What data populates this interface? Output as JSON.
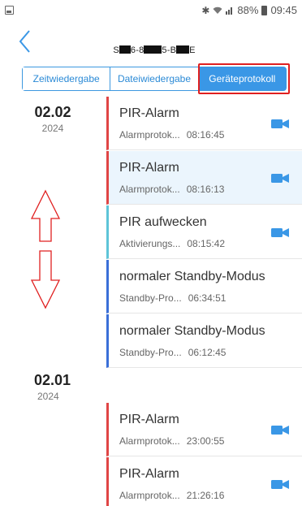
{
  "statusbar": {
    "bluetooth": "✱",
    "battery_percent": "88%",
    "time": "09:45"
  },
  "header": {
    "title_parts": [
      "S",
      "6-8",
      "5-B",
      "E"
    ]
  },
  "tabs": [
    {
      "label": "Zeitwiedergabe",
      "active": false
    },
    {
      "label": "Dateiwiedergabe",
      "active": false
    },
    {
      "label": "Geräteprotokoll",
      "active": true
    }
  ],
  "groups": [
    {
      "day": "02.02",
      "year": "2024",
      "entries": [
        {
          "title": "PIR-Alarm",
          "subtitle": "Alarmprotok...",
          "time": "08:16:45"
        },
        {
          "title": "PIR-Alarm",
          "subtitle": "Alarmprotok...",
          "time": "08:16:13"
        },
        {
          "title": "PIR aufwecken",
          "subtitle": "Aktivierungs...",
          "time": "08:15:42"
        },
        {
          "title": "normaler Standby-Modus",
          "subtitle": "Standby-Pro...",
          "time": "06:34:51"
        },
        {
          "title": "normaler Standby-Modus",
          "subtitle": "Standby-Pro...",
          "time": "06:12:45"
        }
      ]
    },
    {
      "day": "02.01",
      "year": "2024",
      "entries": [
        {
          "title": "PIR-Alarm",
          "subtitle": "Alarmprotok...",
          "time": "23:00:55"
        },
        {
          "title": "PIR-Alarm",
          "subtitle": "Alarmprotok...",
          "time": "21:26:16"
        }
      ]
    }
  ],
  "colors": {
    "accent": "#3a97e6",
    "alarm_bar": "#e04545",
    "wake_bar": "#5ec4d8",
    "standby_bar": "#3a6fd8",
    "annotation_red": "#e02020",
    "camera_icon": "#3a97e6"
  },
  "icons": {
    "back": "chevron-left-icon",
    "camera": "video-camera-icon",
    "annotation": "up-down-arrows-icon"
  }
}
